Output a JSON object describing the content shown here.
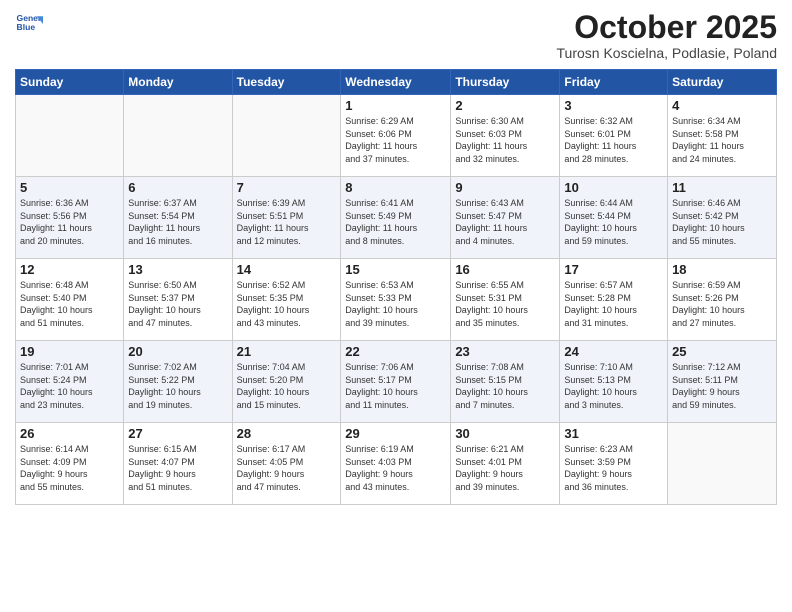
{
  "header": {
    "logo_line1": "General",
    "logo_line2": "Blue",
    "month": "October 2025",
    "location": "Turosn Koscielna, Podlasie, Poland"
  },
  "weekdays": [
    "Sunday",
    "Monday",
    "Tuesday",
    "Wednesday",
    "Thursday",
    "Friday",
    "Saturday"
  ],
  "weeks": [
    [
      {
        "day": "",
        "info": ""
      },
      {
        "day": "",
        "info": ""
      },
      {
        "day": "",
        "info": ""
      },
      {
        "day": "1",
        "info": "Sunrise: 6:29 AM\nSunset: 6:06 PM\nDaylight: 11 hours\nand 37 minutes."
      },
      {
        "day": "2",
        "info": "Sunrise: 6:30 AM\nSunset: 6:03 PM\nDaylight: 11 hours\nand 32 minutes."
      },
      {
        "day": "3",
        "info": "Sunrise: 6:32 AM\nSunset: 6:01 PM\nDaylight: 11 hours\nand 28 minutes."
      },
      {
        "day": "4",
        "info": "Sunrise: 6:34 AM\nSunset: 5:58 PM\nDaylight: 11 hours\nand 24 minutes."
      }
    ],
    [
      {
        "day": "5",
        "info": "Sunrise: 6:36 AM\nSunset: 5:56 PM\nDaylight: 11 hours\nand 20 minutes."
      },
      {
        "day": "6",
        "info": "Sunrise: 6:37 AM\nSunset: 5:54 PM\nDaylight: 11 hours\nand 16 minutes."
      },
      {
        "day": "7",
        "info": "Sunrise: 6:39 AM\nSunset: 5:51 PM\nDaylight: 11 hours\nand 12 minutes."
      },
      {
        "day": "8",
        "info": "Sunrise: 6:41 AM\nSunset: 5:49 PM\nDaylight: 11 hours\nand 8 minutes."
      },
      {
        "day": "9",
        "info": "Sunrise: 6:43 AM\nSunset: 5:47 PM\nDaylight: 11 hours\nand 4 minutes."
      },
      {
        "day": "10",
        "info": "Sunrise: 6:44 AM\nSunset: 5:44 PM\nDaylight: 10 hours\nand 59 minutes."
      },
      {
        "day": "11",
        "info": "Sunrise: 6:46 AM\nSunset: 5:42 PM\nDaylight: 10 hours\nand 55 minutes."
      }
    ],
    [
      {
        "day": "12",
        "info": "Sunrise: 6:48 AM\nSunset: 5:40 PM\nDaylight: 10 hours\nand 51 minutes."
      },
      {
        "day": "13",
        "info": "Sunrise: 6:50 AM\nSunset: 5:37 PM\nDaylight: 10 hours\nand 47 minutes."
      },
      {
        "day": "14",
        "info": "Sunrise: 6:52 AM\nSunset: 5:35 PM\nDaylight: 10 hours\nand 43 minutes."
      },
      {
        "day": "15",
        "info": "Sunrise: 6:53 AM\nSunset: 5:33 PM\nDaylight: 10 hours\nand 39 minutes."
      },
      {
        "day": "16",
        "info": "Sunrise: 6:55 AM\nSunset: 5:31 PM\nDaylight: 10 hours\nand 35 minutes."
      },
      {
        "day": "17",
        "info": "Sunrise: 6:57 AM\nSunset: 5:28 PM\nDaylight: 10 hours\nand 31 minutes."
      },
      {
        "day": "18",
        "info": "Sunrise: 6:59 AM\nSunset: 5:26 PM\nDaylight: 10 hours\nand 27 minutes."
      }
    ],
    [
      {
        "day": "19",
        "info": "Sunrise: 7:01 AM\nSunset: 5:24 PM\nDaylight: 10 hours\nand 23 minutes."
      },
      {
        "day": "20",
        "info": "Sunrise: 7:02 AM\nSunset: 5:22 PM\nDaylight: 10 hours\nand 19 minutes."
      },
      {
        "day": "21",
        "info": "Sunrise: 7:04 AM\nSunset: 5:20 PM\nDaylight: 10 hours\nand 15 minutes."
      },
      {
        "day": "22",
        "info": "Sunrise: 7:06 AM\nSunset: 5:17 PM\nDaylight: 10 hours\nand 11 minutes."
      },
      {
        "day": "23",
        "info": "Sunrise: 7:08 AM\nSunset: 5:15 PM\nDaylight: 10 hours\nand 7 minutes."
      },
      {
        "day": "24",
        "info": "Sunrise: 7:10 AM\nSunset: 5:13 PM\nDaylight: 10 hours\nand 3 minutes."
      },
      {
        "day": "25",
        "info": "Sunrise: 7:12 AM\nSunset: 5:11 PM\nDaylight: 9 hours\nand 59 minutes."
      }
    ],
    [
      {
        "day": "26",
        "info": "Sunrise: 6:14 AM\nSunset: 4:09 PM\nDaylight: 9 hours\nand 55 minutes."
      },
      {
        "day": "27",
        "info": "Sunrise: 6:15 AM\nSunset: 4:07 PM\nDaylight: 9 hours\nand 51 minutes."
      },
      {
        "day": "28",
        "info": "Sunrise: 6:17 AM\nSunset: 4:05 PM\nDaylight: 9 hours\nand 47 minutes."
      },
      {
        "day": "29",
        "info": "Sunrise: 6:19 AM\nSunset: 4:03 PM\nDaylight: 9 hours\nand 43 minutes."
      },
      {
        "day": "30",
        "info": "Sunrise: 6:21 AM\nSunset: 4:01 PM\nDaylight: 9 hours\nand 39 minutes."
      },
      {
        "day": "31",
        "info": "Sunrise: 6:23 AM\nSunset: 3:59 PM\nDaylight: 9 hours\nand 36 minutes."
      },
      {
        "day": "",
        "info": ""
      }
    ]
  ]
}
